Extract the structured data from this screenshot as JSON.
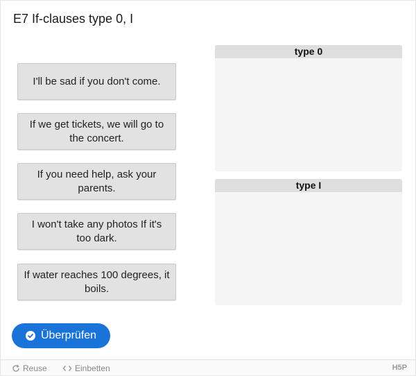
{
  "title": "E7 If-clauses type 0, I",
  "draggables": [
    {
      "text": "I'll be sad if you don't come."
    },
    {
      "text": "If we get tickets, we will go to the concert."
    },
    {
      "text": "If you need help, ask your parents."
    },
    {
      "text": "I won't take any photos If it's too dark."
    },
    {
      "text": "If water reaches 100 degrees, it boils."
    }
  ],
  "dropzones": [
    {
      "label": "type 0"
    },
    {
      "label": "type I"
    }
  ],
  "check_button": {
    "label": "Überprüfen",
    "icon": "check-circle-icon",
    "color": "#1a73d9"
  },
  "footer": {
    "reuse_label": "Reuse",
    "embed_label": "Einbetten",
    "brand": "H5P"
  }
}
